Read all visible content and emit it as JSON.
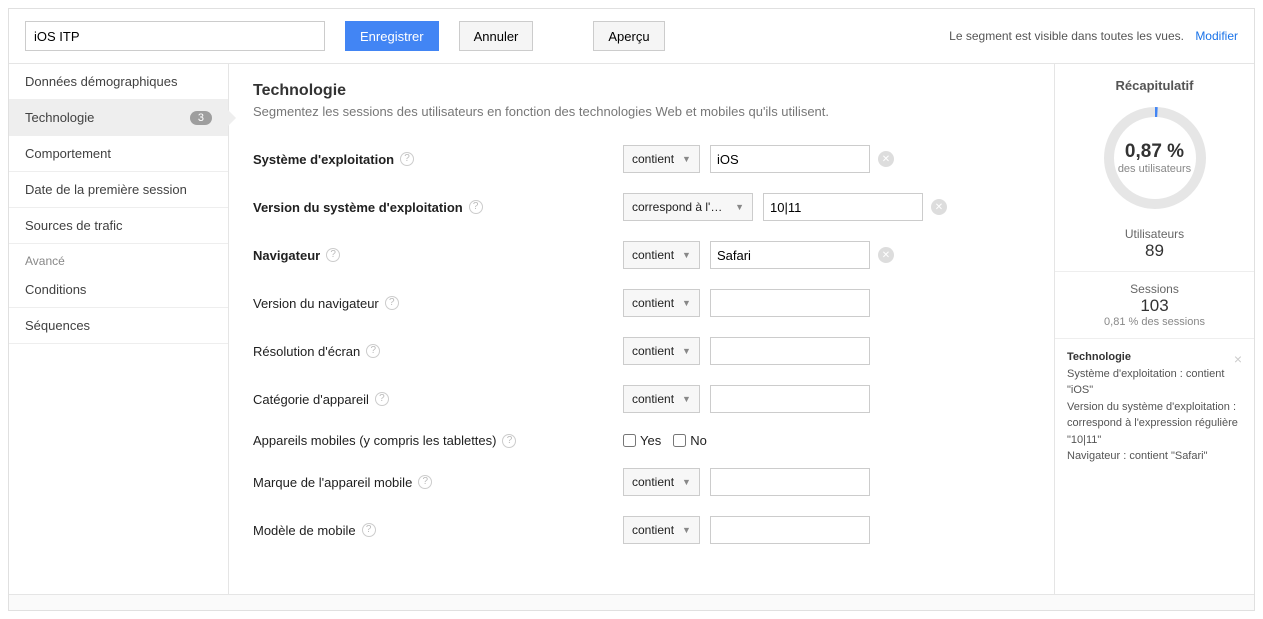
{
  "header": {
    "segment_name": "iOS ITP",
    "save_label": "Enregistrer",
    "cancel_label": "Annuler",
    "preview_label": "Aperçu",
    "visibility_text": "Le segment est visible dans toutes les vues.",
    "change_link": "Modifier"
  },
  "sidebar": {
    "items": [
      {
        "label": "Données démographiques"
      },
      {
        "label": "Technologie",
        "active": true,
        "badge": "3"
      },
      {
        "label": "Comportement"
      },
      {
        "label": "Date de la première session"
      },
      {
        "label": "Sources de trafic"
      }
    ],
    "advanced_label": "Avancé",
    "advanced_items": [
      {
        "label": "Conditions"
      },
      {
        "label": "Séquences"
      }
    ]
  },
  "main": {
    "title": "Technologie",
    "subtitle": "Segmentez les sessions des utilisateurs en fonction des technologies Web et mobiles qu'ils utilisent.",
    "rows": {
      "os": {
        "label": "Système d'exploitation",
        "op": "contient",
        "value": "iOS",
        "bold": true
      },
      "os_version": {
        "label": "Version du système d'exploitation",
        "op": "correspond à l'exp...",
        "value": "10|11",
        "bold": true
      },
      "browser": {
        "label": "Navigateur",
        "op": "contient",
        "value": "Safari",
        "bold": true
      },
      "browser_version": {
        "label": "Version du navigateur",
        "op": "contient",
        "value": ""
      },
      "screen_res": {
        "label": "Résolution d'écran",
        "op": "contient",
        "value": ""
      },
      "device_cat": {
        "label": "Catégorie d'appareil",
        "op": "contient",
        "value": ""
      },
      "mobile_incl": {
        "label": "Appareils mobiles (y compris les tablettes)",
        "yes": "Yes",
        "no": "No"
      },
      "mobile_brand": {
        "label": "Marque de l'appareil mobile",
        "op": "contient",
        "value": ""
      },
      "mobile_model": {
        "label": "Modèle de mobile",
        "op": "contient",
        "value": ""
      }
    }
  },
  "summary": {
    "title": "Récapitulatif",
    "pct": "0,87 %",
    "pct_label": "des utilisateurs",
    "users_label": "Utilisateurs",
    "users_value": "89",
    "sessions_label": "Sessions",
    "sessions_value": "103",
    "sessions_sub": "0,81 % des sessions",
    "tech_title": "Technologie",
    "tech_lines": [
      "Système d'exploitation : contient \"iOS\"",
      "Version du système d'exploitation : correspond à l'expression régulière \"10|11\"",
      "Navigateur : contient \"Safari\""
    ]
  }
}
